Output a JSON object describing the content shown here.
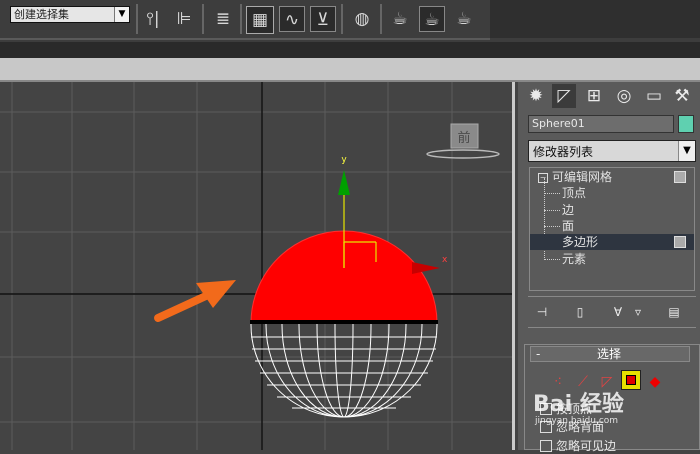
{
  "toolbar": {
    "selection_set": "创建选择集",
    "buttons": [
      {
        "name": "mirror-button",
        "glyph": "⫯"
      },
      {
        "name": "align-button",
        "glyph": "⊫"
      },
      {
        "name": "layer-manager-button",
        "glyph": "≣"
      },
      {
        "name": "scene-explorer-button",
        "glyph": "▦"
      },
      {
        "name": "curve-editor-button",
        "glyph": "∿"
      },
      {
        "name": "dope-sheet-button",
        "glyph": "⊻"
      },
      {
        "name": "material-editor-button",
        "glyph": "◍"
      },
      {
        "name": "render-setup-button",
        "glyph": "☕"
      },
      {
        "name": "rendered-frame-window-button",
        "glyph": "▣"
      },
      {
        "name": "render-button",
        "glyph": "☕"
      }
    ]
  },
  "viewport": {
    "viewcube_label": "前",
    "axis_y": "y",
    "axis_x": "x"
  },
  "panel": {
    "tabs": [
      "create-tab",
      "modify-tab",
      "hierarchy-tab",
      "motion-tab",
      "display-tab",
      "utilities-tab"
    ],
    "object_name": "Sphere01",
    "object_color": "#5fd0b0",
    "modifier_list": "修改器列表",
    "stack": {
      "root": "可编辑网格",
      "items": [
        "顶点",
        "边",
        "面",
        "多边形",
        "元素"
      ],
      "selected": "多边形"
    },
    "rollout": {
      "title": "选择",
      "options": [
        "按顶点",
        "忽略背面",
        "忽略可见边"
      ]
    }
  },
  "watermark": {
    "text": "Bai 经验",
    "sub": "jingyan.baidu.com"
  },
  "colors": {
    "selection_red": "#ff0000",
    "arrow_orange": "#f26a1b",
    "gizmo_green": "#00a000",
    "gizmo_yellow": "#e6e600"
  }
}
